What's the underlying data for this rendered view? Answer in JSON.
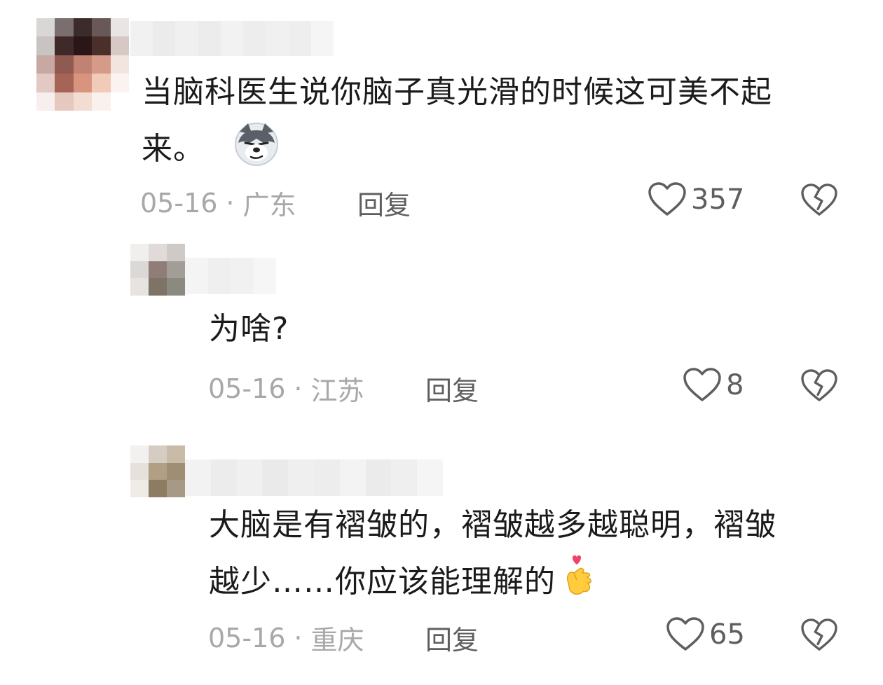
{
  "comments": [
    {
      "text_line1": "当脑科医生说你脑子真光滑的时候这可美不起",
      "text_line2": "来。",
      "date": "05-16",
      "separator": "·",
      "location": "广东",
      "reply_label": "回复",
      "likes": "357",
      "emoji": "husky-dog-emoji"
    },
    {
      "text_line1": "为啥?",
      "date": "05-16",
      "separator": "·",
      "location": "江苏",
      "reply_label": "回复",
      "likes": "8"
    },
    {
      "text_line1": "大脑是有褶皱的，褶皱越多越聪明，褶皱",
      "text_line2": "越少……你应该能理解的",
      "date": "05-16",
      "separator": "·",
      "location": "重庆",
      "reply_label": "回复",
      "likes": "65",
      "emoji": "finger-heart-emoji"
    }
  ],
  "colors": {
    "text": "#1b1b1b",
    "meta": "#a8a8a8",
    "action": "#5e5e5e"
  }
}
